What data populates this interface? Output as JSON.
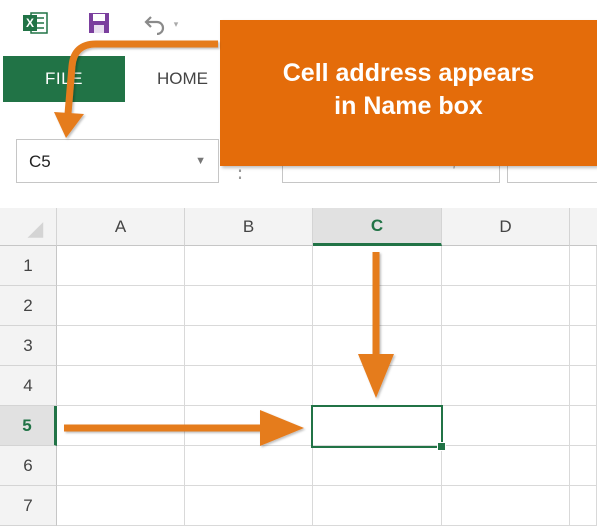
{
  "ribbon": {
    "tab_file": "FILE",
    "tab_home": "HOME"
  },
  "name_box": {
    "value": "C5"
  },
  "callout": {
    "line1": "Cell address appears",
    "line2": "in Name box"
  },
  "grid": {
    "columns": [
      "A",
      "B",
      "C",
      "D"
    ],
    "rows": [
      "1",
      "2",
      "3",
      "4",
      "5",
      "6",
      "7"
    ],
    "selected_cell": "C5"
  },
  "colors": {
    "excel_green": "#217346",
    "callout_orange": "#e46c0a",
    "arrow_orange": "#e57b1e"
  },
  "icons": [
    "excel-logo-icon",
    "save-icon",
    "undo-icon",
    "dropdown-icon",
    "cancel-icon",
    "enter-icon",
    "function-icon",
    "corner-select-all-icon"
  ]
}
